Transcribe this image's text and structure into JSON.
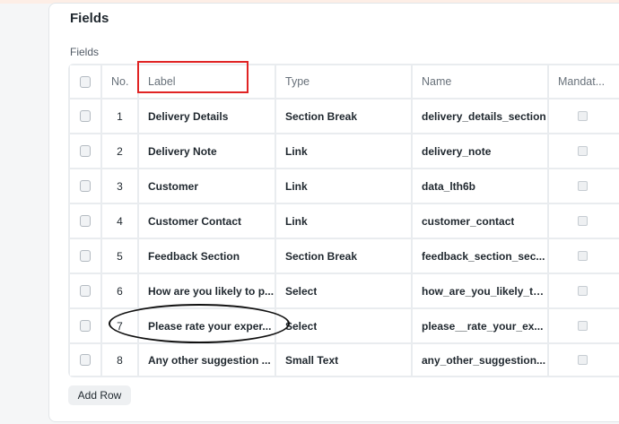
{
  "section": {
    "title": "Fields"
  },
  "table": {
    "label": "Fields",
    "columns": {
      "no": "No.",
      "label": "Label",
      "type": "Type",
      "name": "Name",
      "mandatory": "Mandat..."
    },
    "rows": [
      {
        "no": "1",
        "label": "Delivery Details",
        "type": "Section Break",
        "name": "delivery_details_section",
        "mandatory": false
      },
      {
        "no": "2",
        "label": "Delivery Note",
        "type": "Link",
        "name": "delivery_note",
        "mandatory": false
      },
      {
        "no": "3",
        "label": "Customer",
        "type": "Link",
        "name": "data_lth6b",
        "mandatory": false
      },
      {
        "no": "4",
        "label": "Customer Contact",
        "type": "Link",
        "name": "customer_contact",
        "mandatory": false
      },
      {
        "no": "5",
        "label": "Feedback Section",
        "type": "Section Break",
        "name": "feedback_section_sec...",
        "mandatory": false
      },
      {
        "no": "6",
        "label": "How are you likely to p...",
        "type": "Select",
        "name": "how_are_you_likely_to...",
        "mandatory": false
      },
      {
        "no": "7",
        "label": "Please rate your exper...",
        "type": "Select",
        "name": "please__rate_your_ex...",
        "mandatory": false
      },
      {
        "no": "8",
        "label": "Any other suggestion ...",
        "type": "Small Text",
        "name": "any_other_suggestion...",
        "mandatory": false
      }
    ]
  },
  "actions": {
    "add_row": "Add Row"
  },
  "annotations": {
    "rect_color": "#e02424",
    "ellipse_color": "#111111"
  }
}
